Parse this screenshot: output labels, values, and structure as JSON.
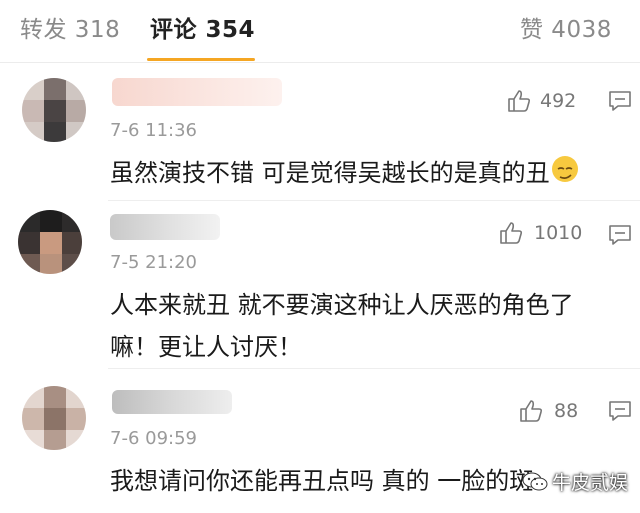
{
  "tabs": {
    "repost": "转发 318",
    "comments": "评论 354",
    "likes": "赞 4038"
  },
  "comments": [
    {
      "time": "7-6 11:36",
      "text": "虽然演技不错 可是觉得吴越长的是真的丑",
      "like_count": "492"
    },
    {
      "time": "7-5 21:20",
      "text_line1": "人本来就丑 就不要演这种让人厌恶的角色了",
      "text_line2": "嘛！更让人讨厌！",
      "like_count": "1010"
    },
    {
      "time": "7-6 09:59",
      "text": "我想请问你还能再丑点吗 真的 一脸的斑",
      "like_count": "88"
    }
  ],
  "watermark": "牛皮贰娱",
  "colors": {
    "accent_underline": "#f5a623",
    "emoji": "#f7c93f"
  },
  "icons": [
    "thumbs-up-icon",
    "reply-comment-icon",
    "smirk-emoji-icon",
    "wechat-logo-icon"
  ]
}
